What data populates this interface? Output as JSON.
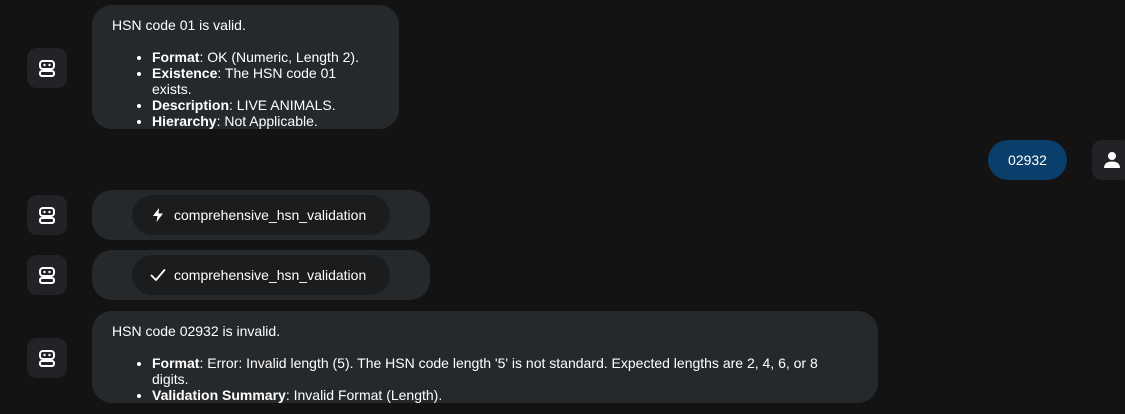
{
  "messages": [
    {
      "lead": "HSN code 01 is valid.",
      "items": [
        {
          "label": "Format",
          "text": ": OK (Numeric, Length 2)."
        },
        {
          "label": "Existence",
          "text": ": The HSN code 01 exists."
        },
        {
          "label": "Description",
          "text": ": LIVE ANIMALS."
        },
        {
          "label": "Hierarchy",
          "text": ": Not Applicable."
        }
      ]
    },
    {
      "lead": "HSN code 02932 is invalid.",
      "items": [
        {
          "label": "Format",
          "text": ": Error: Invalid length (5). The HSN code length '5' is not standard. Expected lengths are 2, 4, 6, or 8 digits."
        },
        {
          "label": "Validation Summary",
          "text": ": Invalid Format (Length)."
        }
      ]
    }
  ],
  "user_message": "02932",
  "tool_calls": [
    {
      "name": "comprehensive_hsn_validation",
      "icon": "lightning-icon",
      "status": "running"
    },
    {
      "name": "comprehensive_hsn_validation",
      "icon": "checkmark-icon",
      "status": "done"
    }
  ],
  "colors": {
    "background": "#131314",
    "bubble": "#26292c",
    "user_bubble": "#0b3f6b",
    "pill": "#1b1c1e"
  }
}
